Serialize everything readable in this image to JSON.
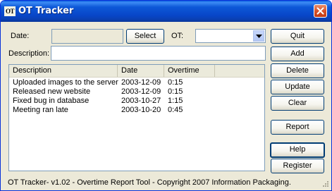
{
  "window": {
    "title": "OT Tracker",
    "app_icon_text": "OT"
  },
  "form": {
    "date_label": "Date:",
    "date_value": "",
    "select_button": "Select",
    "ot_label": "OT:",
    "ot_value": "",
    "description_label": "Description:",
    "description_value": ""
  },
  "buttons": {
    "quit": "Quit",
    "add": "Add",
    "delete": "Delete",
    "update": "Update",
    "clear": "Clear",
    "report": "Report",
    "help": "Help",
    "register": "Register"
  },
  "list": {
    "columns": [
      "Description",
      "Date",
      "Overtime"
    ],
    "rows": [
      {
        "description": "Uploaded images to the server",
        "date": "2003-12-09",
        "overtime": "0:15"
      },
      {
        "description": "Released new website",
        "date": "2003-12-09",
        "overtime": "0:15"
      },
      {
        "description": "Fixed bug in database",
        "date": "2003-10-27",
        "overtime": "1:15"
      },
      {
        "description": "Meeting ran late",
        "date": "2003-10-20",
        "overtime": "0:45"
      }
    ]
  },
  "status": {
    "text": "OT Tracker- v1.02 - Overtime Report Tool - Copyright 2007 Information Packaging."
  },
  "colors": {
    "titlebar": "#0846c8",
    "window_face": "#ece9d8",
    "close_button": "#d8522a"
  }
}
